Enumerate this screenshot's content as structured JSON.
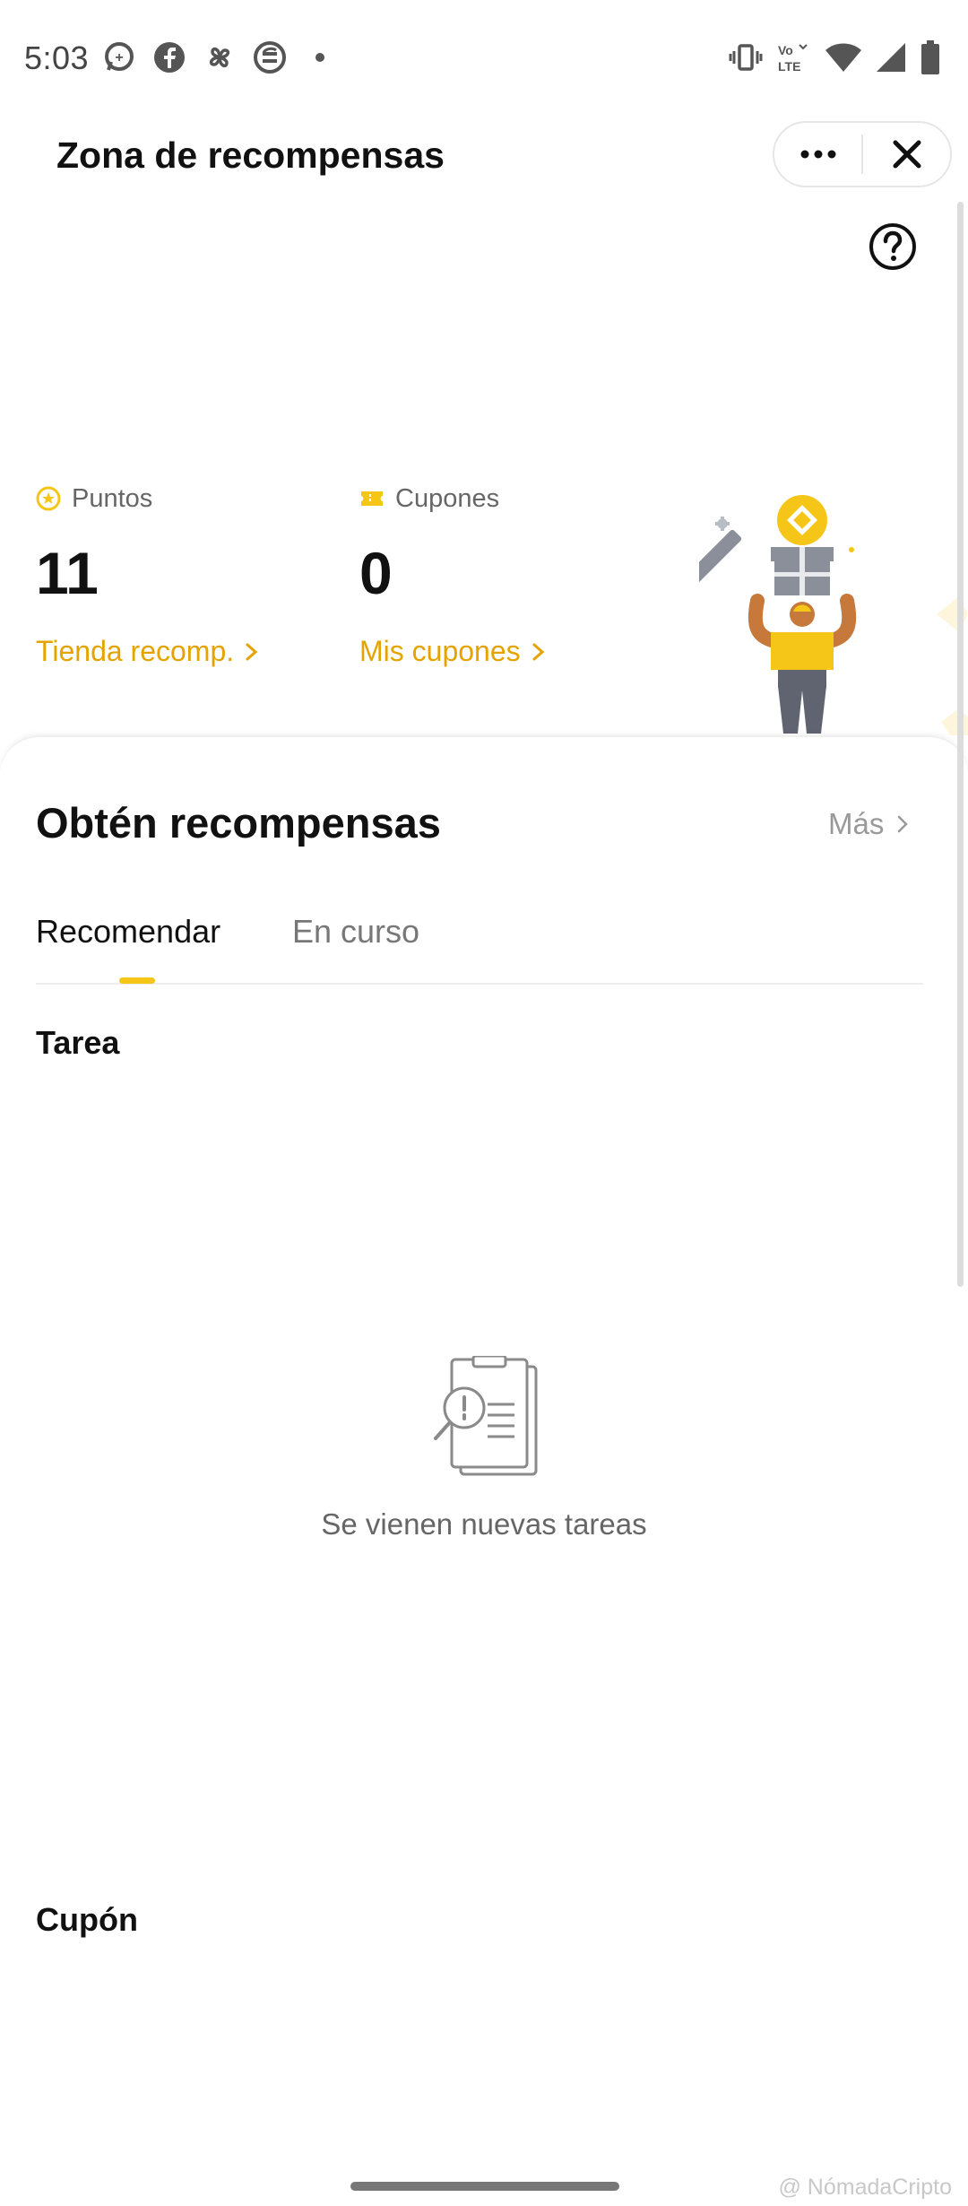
{
  "status_bar": {
    "time": "5:03",
    "left_icons": [
      "whatsapp-icon",
      "facebook-icon",
      "pinwheel-icon",
      "currency-icon",
      "dot-icon"
    ],
    "right_icons": [
      "vibrate-icon",
      "volte-icon",
      "wifi-icon",
      "signal-icon",
      "battery-icon"
    ],
    "volte_label": "Vo LTE"
  },
  "header": {
    "title": "Zona de recompensas",
    "more_icon": "ellipsis-icon",
    "close_icon": "close-icon"
  },
  "summary": {
    "points": {
      "label": "Puntos",
      "value": "11",
      "link": "Tienda recomp."
    },
    "coupons": {
      "label": "Cupones",
      "value": "0",
      "link": "Mis cupones"
    }
  },
  "card": {
    "title": "Obtén recompensas",
    "more": "Más",
    "tabs": [
      {
        "label": "Recomendar",
        "active": true
      },
      {
        "label": "En curso",
        "active": false
      }
    ],
    "sections": {
      "task": "Tarea",
      "coupon": "Cupón"
    },
    "empty": {
      "icon": "clipboard-search-icon",
      "text": "Se vienen nuevas tareas"
    }
  },
  "watermark": "@ NómadaCripto",
  "colors": {
    "accent": "#e5a300",
    "tab_indicator": "#f5c518"
  }
}
